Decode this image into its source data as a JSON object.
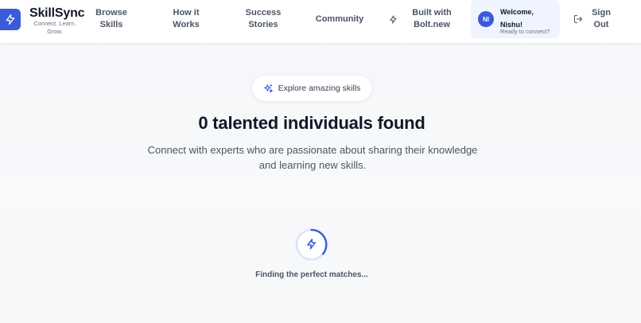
{
  "brand": {
    "name": "SkillSync",
    "tagline": "Connect. Learn. Grow.",
    "color": "#3b5bdb"
  },
  "nav": {
    "browse_skills": "Browse Skills",
    "how_it_works": "How it Works",
    "success_stories": "Success Stories",
    "community": "Community",
    "built_with": "Built with Bolt.new",
    "sign_out": "Sign Out"
  },
  "user": {
    "initials": "NI",
    "welcome": "Welcome, Nishu!",
    "status": "Ready to connect?"
  },
  "main": {
    "pill_label": "Explore amazing skills",
    "headline": "0 talented individuals found",
    "subtitle": "Connect with experts who are passionate about sharing their knowledge and learning new skills.",
    "loading": "Finding the perfect matches..."
  },
  "icons": {
    "logo": "bolt-icon",
    "nav_bolt": "bolt-icon",
    "pill": "sparkles-icon",
    "signout": "sign-out-icon",
    "spinner": "bolt-icon"
  }
}
